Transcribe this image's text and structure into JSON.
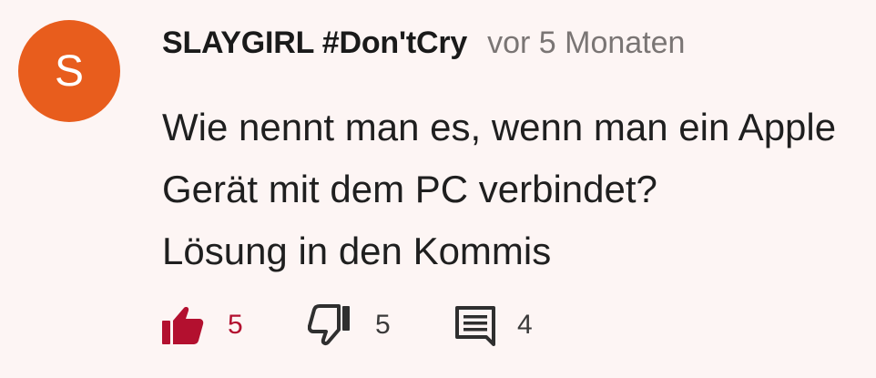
{
  "comment": {
    "avatar_letter": "S",
    "author": "SLAYGIRL #Don'tCry",
    "timestamp": "vor 5 Monaten",
    "text_lines": [
      "Wie nennt man es, wenn man ein Apple",
      "Gerät mit dem PC verbindet?",
      "Lösung in den Kommis"
    ]
  },
  "actions": {
    "like_count": "5",
    "dislike_count": "5",
    "reply_count": "4",
    "like_icon": "thumbs-up-filled-icon",
    "dislike_icon": "thumbs-down-outline-icon",
    "reply_icon": "comment-icon"
  },
  "colors": {
    "background": "#fdf5f4",
    "avatar": "#e85d1d",
    "like_active": "#b3102f",
    "muted_text": "#7a7574"
  }
}
